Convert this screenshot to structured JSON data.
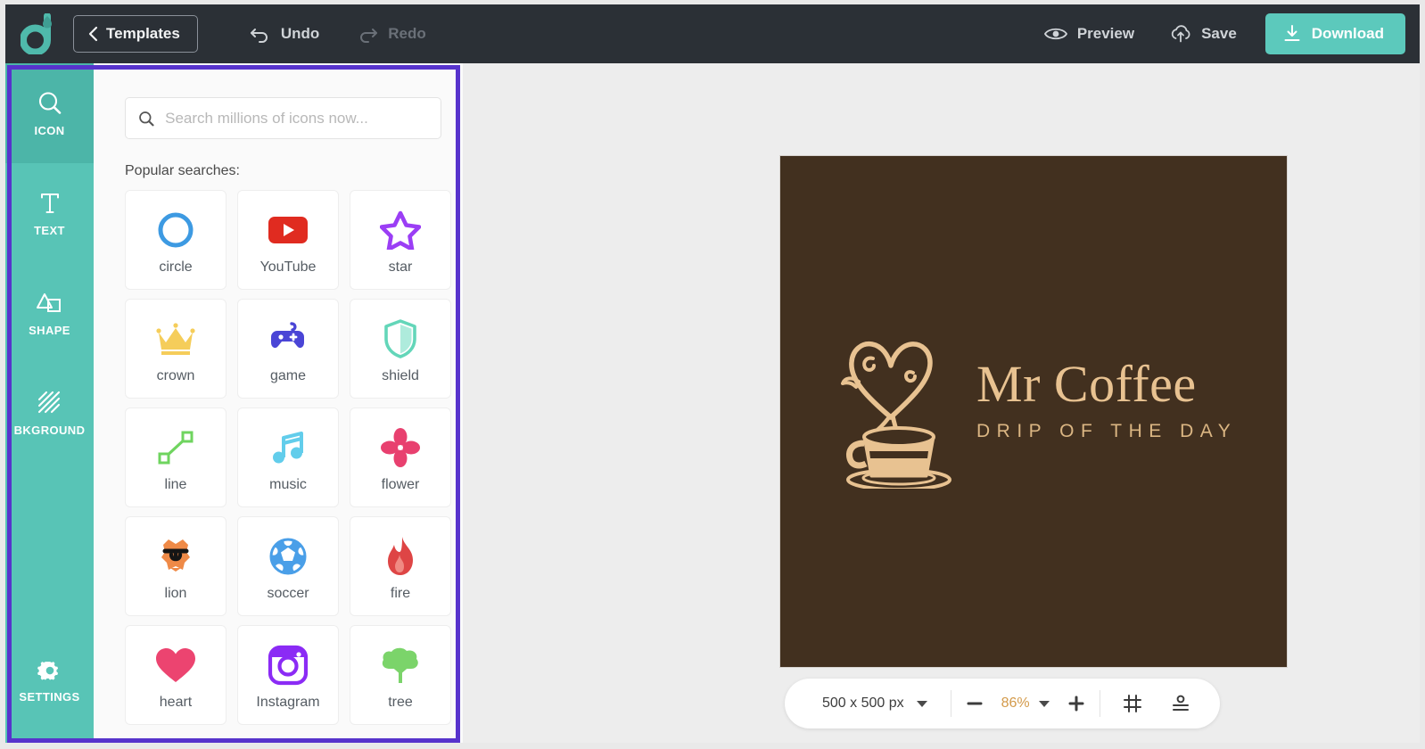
{
  "app": {
    "brand_icon": "droplet-d-logo",
    "accent_teal": "#5cc9bc",
    "rail_teal": "#58c4b6",
    "annotation_purple": "#5733cc",
    "canvas_brown": "#42301f",
    "logo_tan": "#e8c291"
  },
  "header": {
    "templates_label": "Templates",
    "back_icon": "chevron-left-icon",
    "undo_label": "Undo",
    "undo_icon": "undo-arrow-icon",
    "redo_label": "Redo",
    "redo_icon": "redo-arrow-icon",
    "preview_label": "Preview",
    "preview_icon": "eye-icon",
    "save_label": "Save",
    "save_icon": "cloud-upload-icon",
    "download_label": "Download",
    "download_icon": "download-arrow-icon"
  },
  "rail": {
    "items": [
      {
        "label": "ICON",
        "icon": "magnifier-icon",
        "active": true
      },
      {
        "label": "TEXT",
        "icon": "text-t-icon",
        "active": false
      },
      {
        "label": "SHAPE",
        "icon": "shapes-icon",
        "active": false
      },
      {
        "label": "BKGROUND",
        "icon": "hatch-pattern-icon",
        "active": false
      }
    ],
    "settings": {
      "label": "SETTINGS",
      "icon": "gear-icon"
    }
  },
  "panel": {
    "search": {
      "placeholder": "Search millions of icons now...",
      "value": "",
      "icon": "search-icon"
    },
    "popular_label": "Popular searches:",
    "icons": [
      {
        "label": "circle",
        "icon": "circle-icon",
        "color": "#3d9ae2"
      },
      {
        "label": "YouTube",
        "icon": "youtube-icon",
        "color": "#e02b20"
      },
      {
        "label": "star",
        "icon": "star-icon",
        "color": "#9b3ef5"
      },
      {
        "label": "crown",
        "icon": "crown-icon",
        "color": "#f5cd5a"
      },
      {
        "label": "game",
        "icon": "gamepad-icon",
        "color": "#4a45d6"
      },
      {
        "label": "shield",
        "icon": "shield-icon",
        "color": "#63d6b9"
      },
      {
        "label": "line",
        "icon": "line-icon",
        "color": "#6fd45f"
      },
      {
        "label": "music",
        "icon": "music-note-icon",
        "color": "#62cdeb"
      },
      {
        "label": "flower",
        "icon": "flower-icon",
        "color": "#e8406f"
      },
      {
        "label": "lion",
        "icon": "lion-icon",
        "color": "#ef8a47"
      },
      {
        "label": "soccer",
        "icon": "soccer-ball-icon",
        "color": "#4a9fe8"
      },
      {
        "label": "fire",
        "icon": "fire-icon",
        "color": "#de4545"
      },
      {
        "label": "heart",
        "icon": "heart-icon",
        "color": "#ec4470"
      },
      {
        "label": "Instagram",
        "icon": "instagram-icon",
        "color": "#8b2bf5"
      },
      {
        "label": "tree",
        "icon": "tree-icon",
        "color": "#7bd46a"
      }
    ]
  },
  "canvas": {
    "logo_mark": "coffee-cup-heart-steam-icon",
    "title": "Mr Coffee",
    "tagline": "DRIP OF THE DAY"
  },
  "bottom_toolbar": {
    "size_label": "500 x 500 px",
    "size_caret": "chevron-down-icon",
    "zoom_out_icon": "minus-icon",
    "zoom_level": "86%",
    "zoom_caret": "chevron-down-icon",
    "zoom_in_icon": "plus-icon",
    "grid_icon": "grid-icon",
    "align_icon": "align-bottom-icon"
  }
}
